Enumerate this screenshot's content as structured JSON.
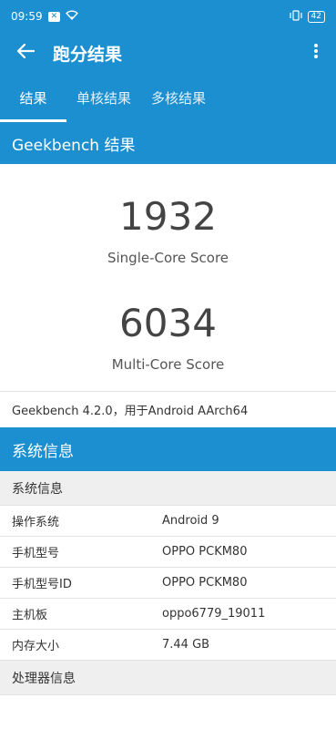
{
  "status": {
    "time": "09:59",
    "battery": "42"
  },
  "appbar": {
    "title": "跑分结果"
  },
  "tabs": [
    {
      "label": "结果"
    },
    {
      "label": "单核结果"
    },
    {
      "label": "多核结果"
    }
  ],
  "geekbench_header": "Geekbench 结果",
  "scores": {
    "single_value": "1932",
    "single_label": "Single-Core Score",
    "multi_value": "6034",
    "multi_label": "Multi-Core Score"
  },
  "version_text": "Geekbench 4.2.0，用于Android AArch64",
  "system_header": "系统信息",
  "system_group": "系统信息",
  "system_rows": [
    {
      "label": "操作系统",
      "value": "Android 9"
    },
    {
      "label": "手机型号",
      "value": "OPPO PCKM80"
    },
    {
      "label": "手机型号ID",
      "value": "OPPO PCKM80"
    },
    {
      "label": "主机板",
      "value": "oppo6779_19011"
    },
    {
      "label": "内存大小",
      "value": "7.44 GB"
    }
  ],
  "processor_group": "处理器信息",
  "colors": {
    "primary": "#1b8fd0"
  }
}
